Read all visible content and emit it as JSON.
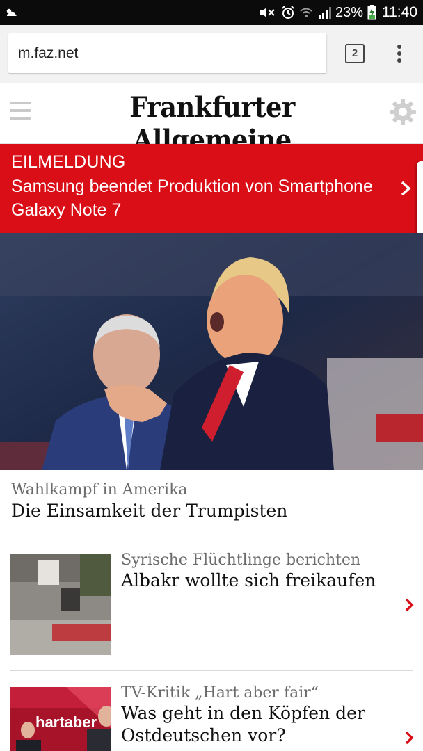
{
  "status_bar": {
    "battery_percent": "23%",
    "time": "11:40"
  },
  "browser": {
    "url": "m.faz.net",
    "tab_count": "2"
  },
  "site": {
    "logo_text": "Frankfurter Allgemeine"
  },
  "breaking": {
    "label": "EILMELDUNG",
    "headline": "Samsung beendet Produktion von Smartphone Galaxy Note 7"
  },
  "lead_article": {
    "kicker": "Wahlkampf in Amerika",
    "title": "Die Einsamkeit der Trumpisten"
  },
  "articles": [
    {
      "kicker": "Syrische Flüchtlinge berichten",
      "title": "Albakr wollte sich freikaufen",
      "thumb_text": ""
    },
    {
      "kicker": "TV-Kritik „Hart aber fair“",
      "title": "Was geht in den Köpfen der Ostdeutschen vor?",
      "thumb_text": "hartaber"
    }
  ],
  "colors": {
    "accent_red": "#d90e16",
    "status_bar": "#0b0b0b",
    "chrome_bg": "#f2f2f2"
  }
}
